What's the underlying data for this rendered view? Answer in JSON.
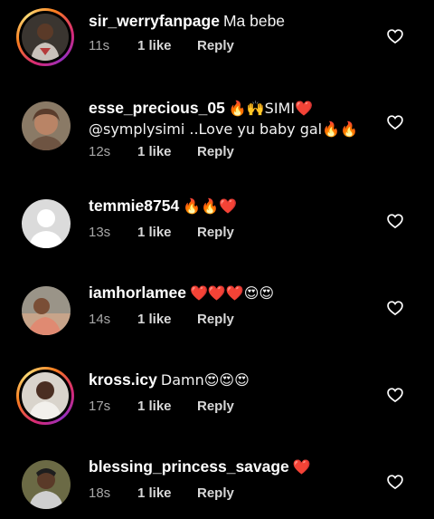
{
  "comments": [
    {
      "username": "sir_werryfanpage",
      "text": "Ma bebe",
      "text_line2": "",
      "time": "11s",
      "likes": "1 like",
      "reply": "Reply",
      "has_story_ring": true
    },
    {
      "username": "esse_precious_05",
      "text": "🔥🙌SIMI❤️",
      "text_line2": "@symplysimi ..Love yu baby gal🔥🔥",
      "time": "12s",
      "likes": "1 like",
      "reply": "Reply",
      "has_story_ring": false
    },
    {
      "username": "temmie8754",
      "text": "🔥🔥❤️",
      "text_line2": "",
      "time": "13s",
      "likes": "1 like",
      "reply": "Reply",
      "has_story_ring": false
    },
    {
      "username": "iamhorlamee",
      "text": "❤️❤️❤️😍😍",
      "text_line2": "",
      "time": "14s",
      "likes": "1 like",
      "reply": "Reply",
      "has_story_ring": false
    },
    {
      "username": "kross.icy",
      "text": "Damn😍😍😍",
      "text_line2": "",
      "time": "17s",
      "likes": "1 like",
      "reply": "Reply",
      "has_story_ring": true
    },
    {
      "username": "blessing_princess_savage",
      "text": "❤️",
      "text_line2": "",
      "time": "18s",
      "likes": "1 like",
      "reply": "Reply",
      "has_story_ring": false
    }
  ],
  "icons": {
    "like": "heart-outline-icon"
  },
  "colors": {
    "background": "#000000",
    "meta_text": "#a8a8a8",
    "heart_outline": "#ffffff"
  }
}
